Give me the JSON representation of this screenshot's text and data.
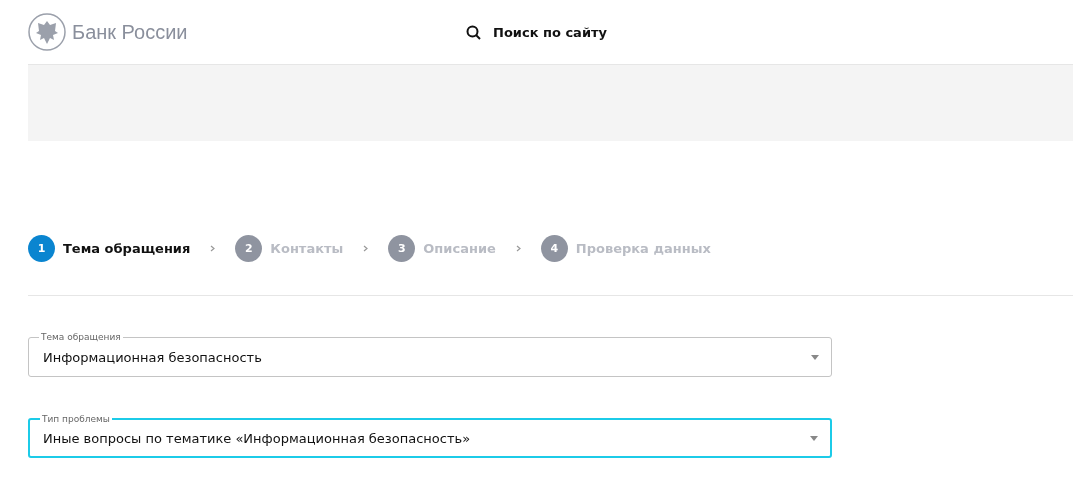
{
  "header": {
    "logo_text": "Банк России",
    "search_label": "Поиск по сайту"
  },
  "banner": {
    "kind": "empty"
  },
  "steps": [
    {
      "number": "1",
      "label": "Тема обращения",
      "selected": true
    },
    {
      "number": "2",
      "label": "Контакты",
      "selected": false
    },
    {
      "number": "3",
      "label": "Описание",
      "selected": false
    },
    {
      "number": "4",
      "label": "Проверка данных",
      "selected": false
    }
  ],
  "fields": [
    {
      "label": "Тема обращения",
      "value": "Информационная безопасность",
      "focused": false
    },
    {
      "label": "Тип проблемы",
      "value": "Иные вопросы по тематике «Информационная безопасность»",
      "focused": true
    }
  ]
}
